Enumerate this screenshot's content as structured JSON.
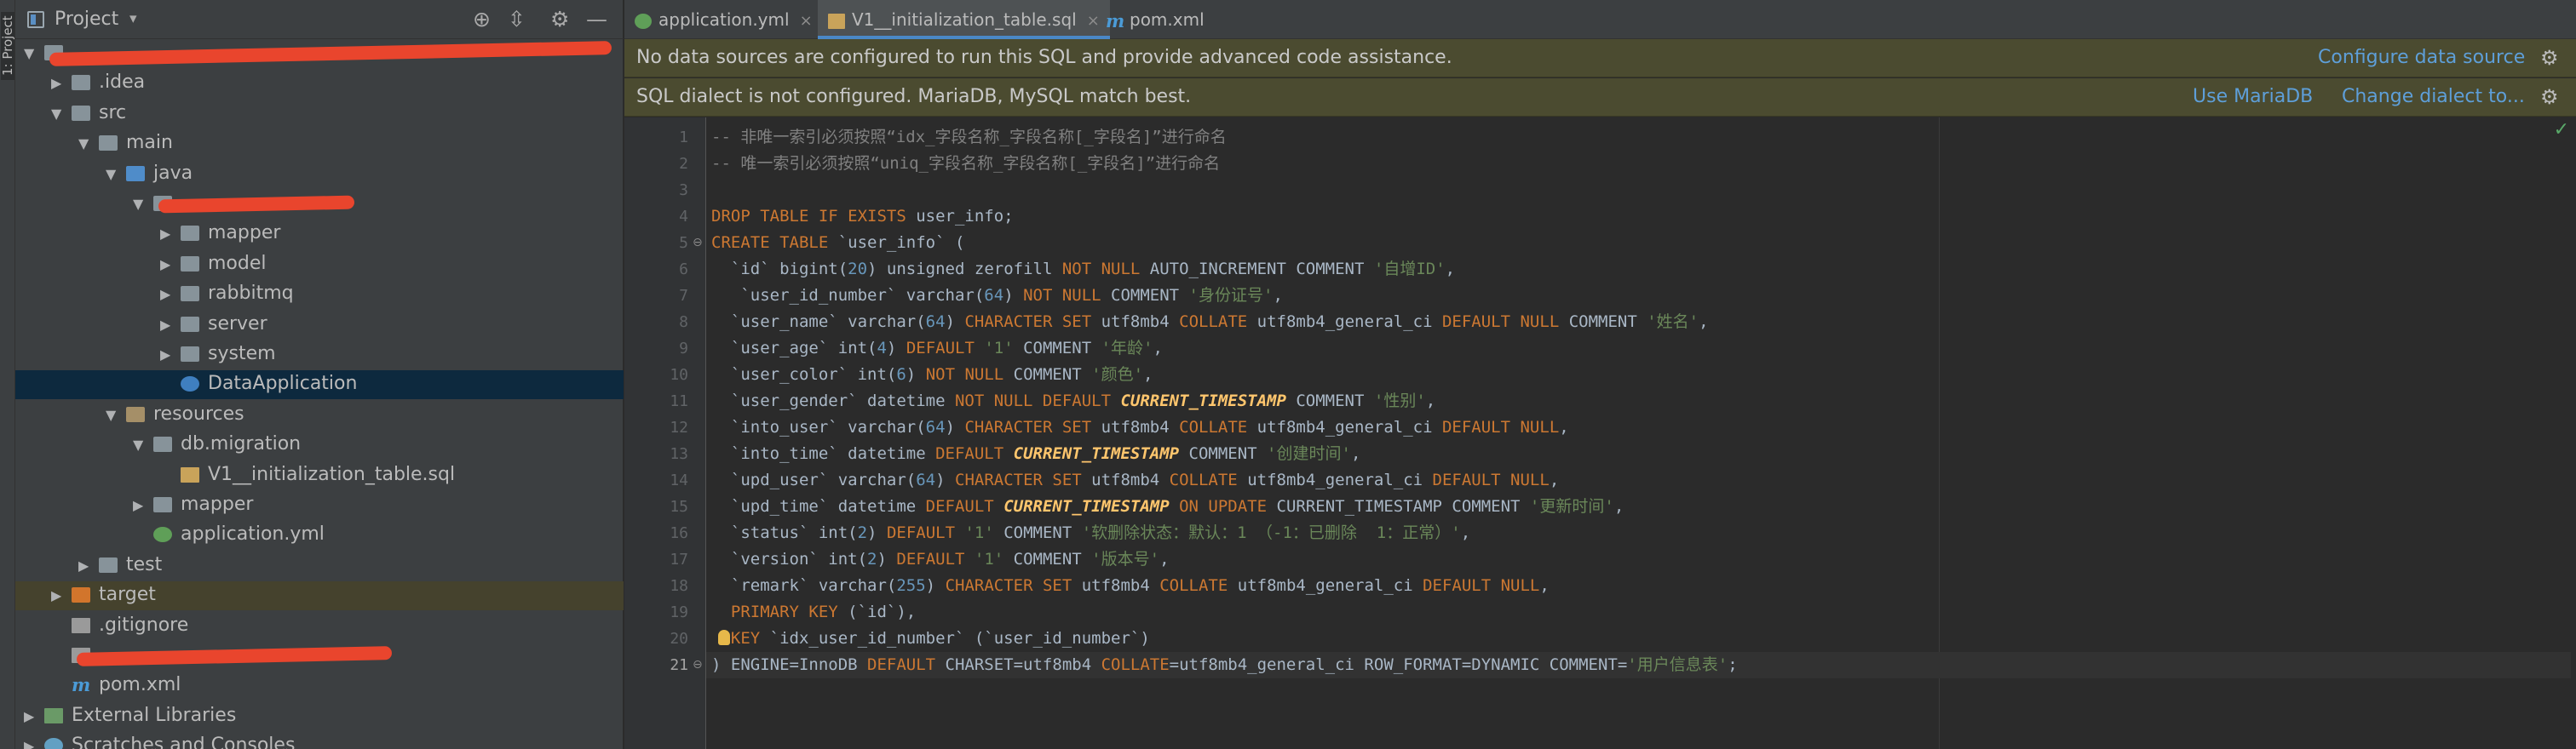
{
  "project_panel": {
    "title": "Project",
    "dropdown_glyph": "▾",
    "toolbar_icons": [
      "locate-icon",
      "collapse-icon",
      "settings-icon",
      "minimize-icon"
    ],
    "side_strip_label": "1: Project"
  },
  "tree": [
    {
      "label": "",
      "depth": 0,
      "expanded": true,
      "icon": "module-folder",
      "redacted": true,
      "red_width": 690
    },
    {
      "label": ".idea",
      "depth": 1,
      "expanded": false,
      "icon": "folder"
    },
    {
      "label": "src",
      "depth": 1,
      "expanded": true,
      "icon": "folder"
    },
    {
      "label": "main",
      "depth": 2,
      "expanded": true,
      "icon": "folder"
    },
    {
      "label": "java",
      "depth": 3,
      "expanded": true,
      "icon": "source-folder"
    },
    {
      "label": "",
      "depth": 4,
      "expanded": true,
      "icon": "package",
      "redacted": true,
      "red_width": 230
    },
    {
      "label": "mapper",
      "depth": 5,
      "expanded": false,
      "icon": "package"
    },
    {
      "label": "model",
      "depth": 5,
      "expanded": false,
      "icon": "package"
    },
    {
      "label": "rabbitmq",
      "depth": 5,
      "expanded": false,
      "icon": "package"
    },
    {
      "label": "server",
      "depth": 5,
      "expanded": false,
      "icon": "package"
    },
    {
      "label": "system",
      "depth": 5,
      "expanded": false,
      "icon": "package"
    },
    {
      "label": "DataApplication",
      "depth": 5,
      "leaf": true,
      "icon": "spring-class",
      "selected": true
    },
    {
      "label": "resources",
      "depth": 3,
      "expanded": true,
      "icon": "resources-folder"
    },
    {
      "label": "db.migration",
      "depth": 4,
      "expanded": true,
      "icon": "folder"
    },
    {
      "label": "V1__initialization_table.sql",
      "depth": 5,
      "leaf": true,
      "icon": "sql-file"
    },
    {
      "label": "mapper",
      "depth": 4,
      "expanded": false,
      "icon": "folder"
    },
    {
      "label": "application.yml",
      "depth": 4,
      "leaf": true,
      "icon": "yml-file"
    },
    {
      "label": "test",
      "depth": 2,
      "expanded": false,
      "icon": "folder"
    },
    {
      "label": "target",
      "depth": 1,
      "expanded": false,
      "icon": "excluded-folder",
      "highlighted": true
    },
    {
      "label": ".gitignore",
      "depth": 1,
      "leaf": true,
      "icon": "text-file"
    },
    {
      "label": "",
      "depth": 1,
      "leaf": true,
      "icon": "text-file",
      "redacted": true,
      "red_width": 370
    },
    {
      "label": "pom.xml",
      "depth": 1,
      "leaf": true,
      "icon": "maven-file"
    },
    {
      "label": "External Libraries",
      "depth": 0,
      "expanded": false,
      "icon": "library"
    },
    {
      "label": "Scratches and Consoles",
      "depth": 0,
      "expanded": false,
      "icon": "scratches"
    }
  ],
  "tabs": [
    {
      "label": "application.yml",
      "icon": "yml-file",
      "active": false
    },
    {
      "label": "V1__initialization_table.sql",
      "icon": "sql-file",
      "active": true
    },
    {
      "label": "pom.xml",
      "icon": "maven-file",
      "active": false
    }
  ],
  "close_glyph": "×",
  "banners": [
    {
      "text": "No data sources are configured to run this SQL and provide advanced code assistance.",
      "links": [
        "Configure data source"
      ],
      "gear": "⚙"
    },
    {
      "text": "SQL dialect is not configured. MariaDB, MySQL match best.",
      "links": [
        "Use MariaDB",
        "Change dialect to..."
      ],
      "gear": "⚙"
    }
  ],
  "editor": {
    "current_line": 21,
    "inspection_ok": "✓",
    "lines": [
      [
        [
          "c",
          "-- 非唯一索引必须按照“idx_字段名称_字段名称[_字段名]”进行命名"
        ]
      ],
      [
        [
          "c",
          "-- 唯一索引必须按照“uniq_字段名称_字段名称[_字段名]”进行命名"
        ]
      ],
      [],
      [
        [
          "k",
          "DROP TABLE IF EXISTS "
        ],
        [
          "p",
          "user_info;"
        ]
      ],
      [
        [
          "k",
          "CREATE TABLE "
        ],
        [
          "p",
          "`user_info` ("
        ]
      ],
      [
        [
          "p",
          "  `id` bigint("
        ],
        [
          "n",
          "20"
        ],
        [
          "p",
          ") unsigned zerofill "
        ],
        [
          "k",
          "NOT NULL "
        ],
        [
          "p",
          "AUTO_INCREMENT COMMENT "
        ],
        [
          "s",
          "'自增ID'"
        ],
        [
          "p",
          ","
        ]
      ],
      [
        [
          "p",
          "   `user_id_number` varchar("
        ],
        [
          "n",
          "64"
        ],
        [
          "p",
          ") "
        ],
        [
          "k",
          "NOT NULL "
        ],
        [
          "p",
          "COMMENT "
        ],
        [
          "s",
          "'身份证号'"
        ],
        [
          "p",
          ","
        ]
      ],
      [
        [
          "p",
          "  `user_name` varchar("
        ],
        [
          "n",
          "64"
        ],
        [
          "p",
          ") "
        ],
        [
          "k",
          "CHARACTER SET "
        ],
        [
          "p",
          "utf8mb4 "
        ],
        [
          "k",
          "COLLATE "
        ],
        [
          "p",
          "utf8mb4_general_ci "
        ],
        [
          "k",
          "DEFAULT NULL "
        ],
        [
          "p",
          "COMMENT "
        ],
        [
          "s",
          "'姓名'"
        ],
        [
          "p",
          ","
        ]
      ],
      [
        [
          "p",
          "  `user_age` int("
        ],
        [
          "n",
          "4"
        ],
        [
          "p",
          ") "
        ],
        [
          "k",
          "DEFAULT "
        ],
        [
          "s",
          "'1'"
        ],
        [
          "p",
          " COMMENT "
        ],
        [
          "s",
          "'年龄'"
        ],
        [
          "p",
          ","
        ]
      ],
      [
        [
          "p",
          "  `user_color` int("
        ],
        [
          "n",
          "6"
        ],
        [
          "p",
          ") "
        ],
        [
          "k",
          "NOT NULL "
        ],
        [
          "p",
          "COMMENT "
        ],
        [
          "s",
          "'颜色'"
        ],
        [
          "p",
          ","
        ]
      ],
      [
        [
          "p",
          "  `user_gender` datetime "
        ],
        [
          "k",
          "NOT NULL DEFAULT "
        ],
        [
          "f",
          "CURRENT_TIMESTAMP"
        ],
        [
          "p",
          " COMMENT "
        ],
        [
          "s",
          "'性别'"
        ],
        [
          "p",
          ","
        ]
      ],
      [
        [
          "p",
          "  `into_user` varchar("
        ],
        [
          "n",
          "64"
        ],
        [
          "p",
          ") "
        ],
        [
          "k",
          "CHARACTER SET "
        ],
        [
          "p",
          "utf8mb4 "
        ],
        [
          "k",
          "COLLATE "
        ],
        [
          "p",
          "utf8mb4_general_ci "
        ],
        [
          "k",
          "DEFAULT NULL"
        ],
        [
          "p",
          ","
        ]
      ],
      [
        [
          "p",
          "  `into_time` datetime "
        ],
        [
          "k",
          "DEFAULT "
        ],
        [
          "f",
          "CURRENT_TIMESTAMP"
        ],
        [
          "p",
          " COMMENT "
        ],
        [
          "s",
          "'创建时间'"
        ],
        [
          "p",
          ","
        ]
      ],
      [
        [
          "p",
          "  `upd_user` varchar("
        ],
        [
          "n",
          "64"
        ],
        [
          "p",
          ") "
        ],
        [
          "k",
          "CHARACTER SET "
        ],
        [
          "p",
          "utf8mb4 "
        ],
        [
          "k",
          "COLLATE "
        ],
        [
          "p",
          "utf8mb4_general_ci "
        ],
        [
          "k",
          "DEFAULT NULL"
        ],
        [
          "p",
          ","
        ]
      ],
      [
        [
          "p",
          "  `upd_time` datetime "
        ],
        [
          "k",
          "DEFAULT "
        ],
        [
          "f",
          "CURRENT_TIMESTAMP"
        ],
        [
          "k",
          " ON UPDATE "
        ],
        [
          "p",
          "CURRENT_TIMESTAMP COMMENT "
        ],
        [
          "s",
          "'更新时间'"
        ],
        [
          "p",
          ","
        ]
      ],
      [
        [
          "p",
          "  `status` int("
        ],
        [
          "n",
          "2"
        ],
        [
          "p",
          ") "
        ],
        [
          "k",
          "DEFAULT "
        ],
        [
          "s",
          "'1'"
        ],
        [
          "p",
          " COMMENT "
        ],
        [
          "s",
          "'软删除状态：默认：1 （-1：已删除  1：正常）'"
        ],
        [
          "p",
          ","
        ]
      ],
      [
        [
          "p",
          "  `version` int("
        ],
        [
          "n",
          "2"
        ],
        [
          "p",
          ") "
        ],
        [
          "k",
          "DEFAULT "
        ],
        [
          "s",
          "'1'"
        ],
        [
          "p",
          " COMMENT "
        ],
        [
          "s",
          "'版本号'"
        ],
        [
          "p",
          ","
        ]
      ],
      [
        [
          "p",
          "  `remark` varchar("
        ],
        [
          "n",
          "255"
        ],
        [
          "p",
          ") "
        ],
        [
          "k",
          "CHARACTER SET "
        ],
        [
          "p",
          "utf8mb4 "
        ],
        [
          "k",
          "COLLATE "
        ],
        [
          "p",
          "utf8mb4_general_ci "
        ],
        [
          "k",
          "DEFAULT NULL"
        ],
        [
          "p",
          ","
        ]
      ],
      [
        [
          "k",
          "  PRIMARY KEY "
        ],
        [
          "p",
          "(`id`),"
        ]
      ],
      [
        [
          "k",
          "  KEY "
        ],
        [
          "p",
          "`idx_user_id_number` (`user_id_number`)"
        ]
      ],
      [
        [
          "p",
          ") ENGINE=InnoDB "
        ],
        [
          "k",
          "DEFAULT "
        ],
        [
          "p",
          "CHARSET=utf8mb4 "
        ],
        [
          "k",
          "COLLATE"
        ],
        [
          "p",
          "=utf8mb4_general_ci ROW_FORMAT=DYNAMIC COMMENT="
        ],
        [
          "s",
          "'用户信息表'"
        ],
        [
          "p",
          ";"
        ]
      ]
    ]
  },
  "colors": {
    "keyword": "#cc7832",
    "string": "#6a8759",
    "number": "#6897bb",
    "comment": "#808080",
    "plain": "#a9b7c6",
    "function": "#ffc66d",
    "link": "#5e9fd9",
    "banner_bg": "#4b4b30"
  }
}
